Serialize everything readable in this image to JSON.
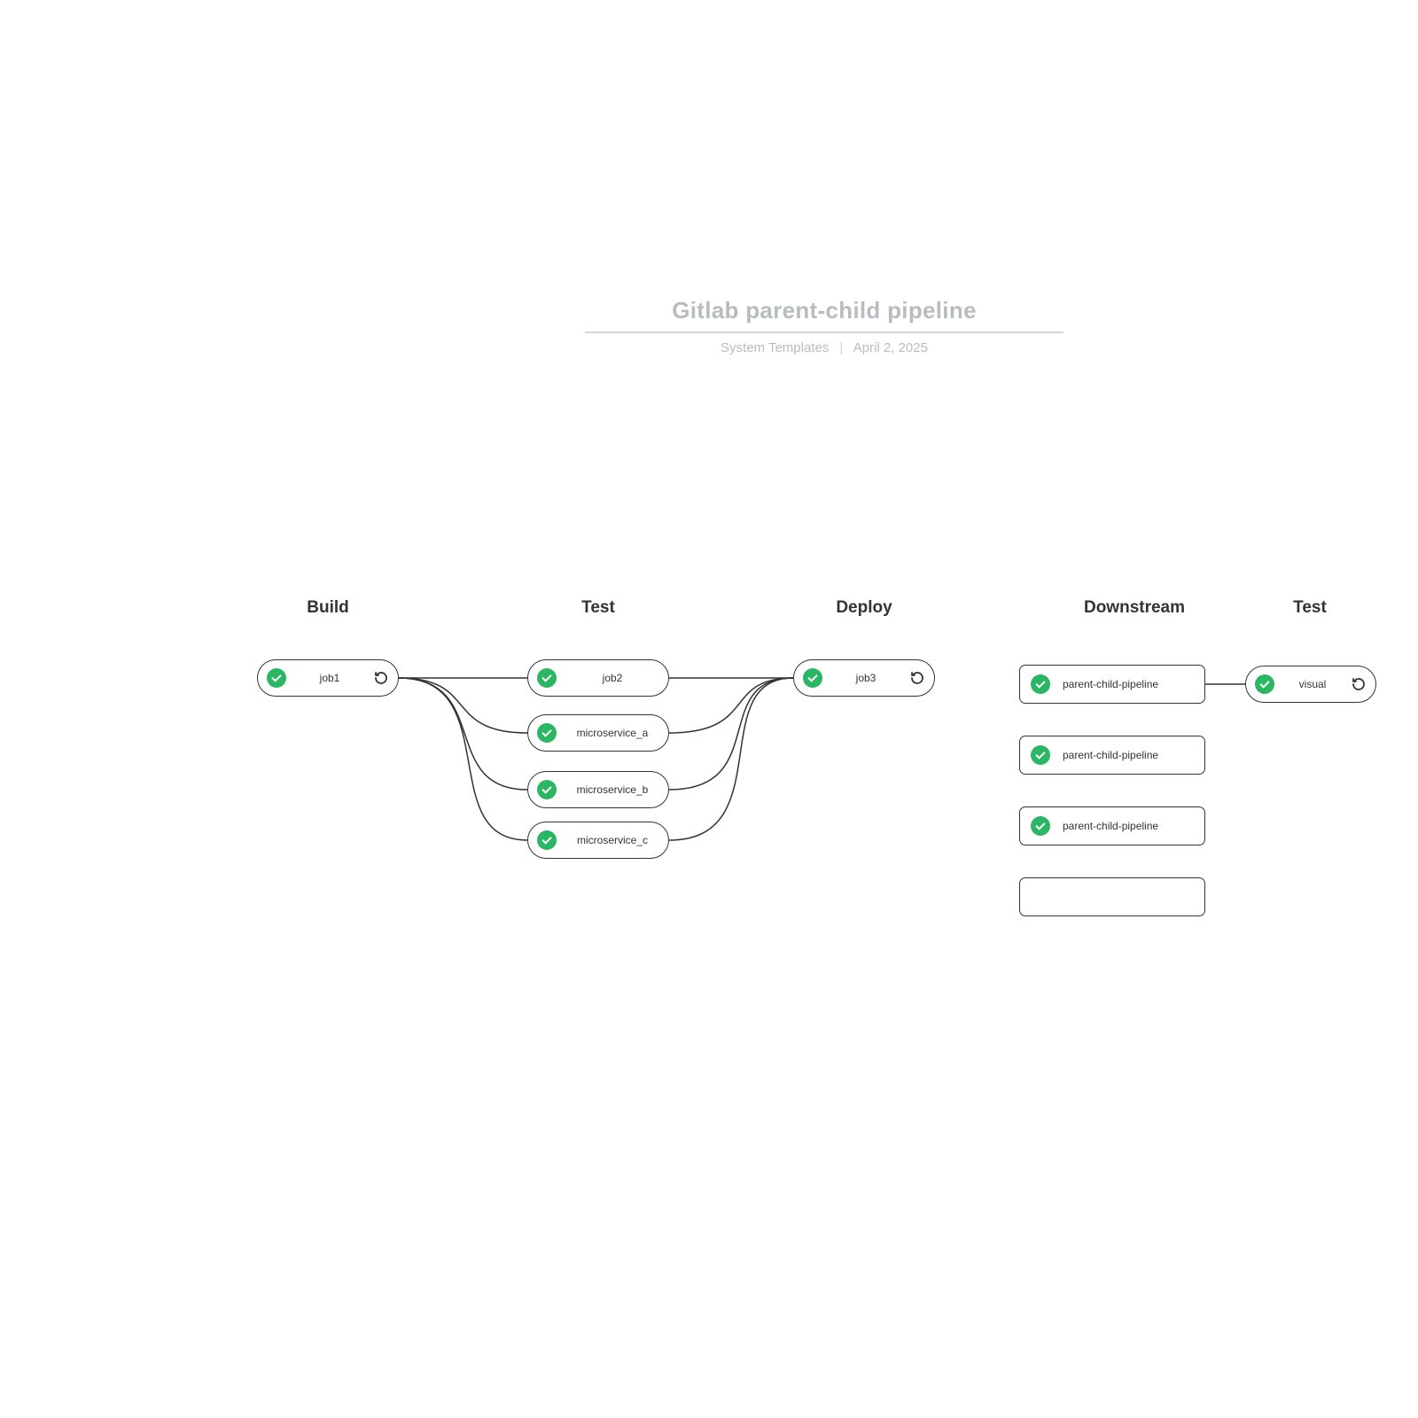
{
  "header": {
    "title": "Gitlab parent-child pipeline",
    "source": "System Templates",
    "date": "April 2, 2025"
  },
  "stages": {
    "build": {
      "label": "Build"
    },
    "test": {
      "label": "Test"
    },
    "deploy": {
      "label": "Deploy"
    },
    "downstream": {
      "label": "Downstream"
    },
    "test2": {
      "label": "Test"
    }
  },
  "jobs": {
    "job1": {
      "label": "job1",
      "status": "passed",
      "retryable": true
    },
    "job2": {
      "label": "job2",
      "status": "passed",
      "retryable": false
    },
    "ms_a": {
      "label": "microservice_a",
      "status": "passed",
      "retryable": false
    },
    "ms_b": {
      "label": "microservice_b",
      "status": "passed",
      "retryable": false
    },
    "ms_c": {
      "label": "microservice_c",
      "status": "passed",
      "retryable": false
    },
    "job3": {
      "label": "job3",
      "status": "passed",
      "retryable": true
    },
    "ds1": {
      "label": "parent-child-pipeline",
      "status": "passed"
    },
    "ds2": {
      "label": "parent-child-pipeline",
      "status": "passed"
    },
    "ds3": {
      "label": "parent-child-pipeline",
      "status": "passed"
    },
    "ds4": {
      "label": ""
    },
    "visual": {
      "label": "visual",
      "status": "passed",
      "retryable": true
    }
  },
  "colors": {
    "passed": "#2bb664",
    "border": "#333333",
    "title_grey": "#b9bcbf"
  }
}
